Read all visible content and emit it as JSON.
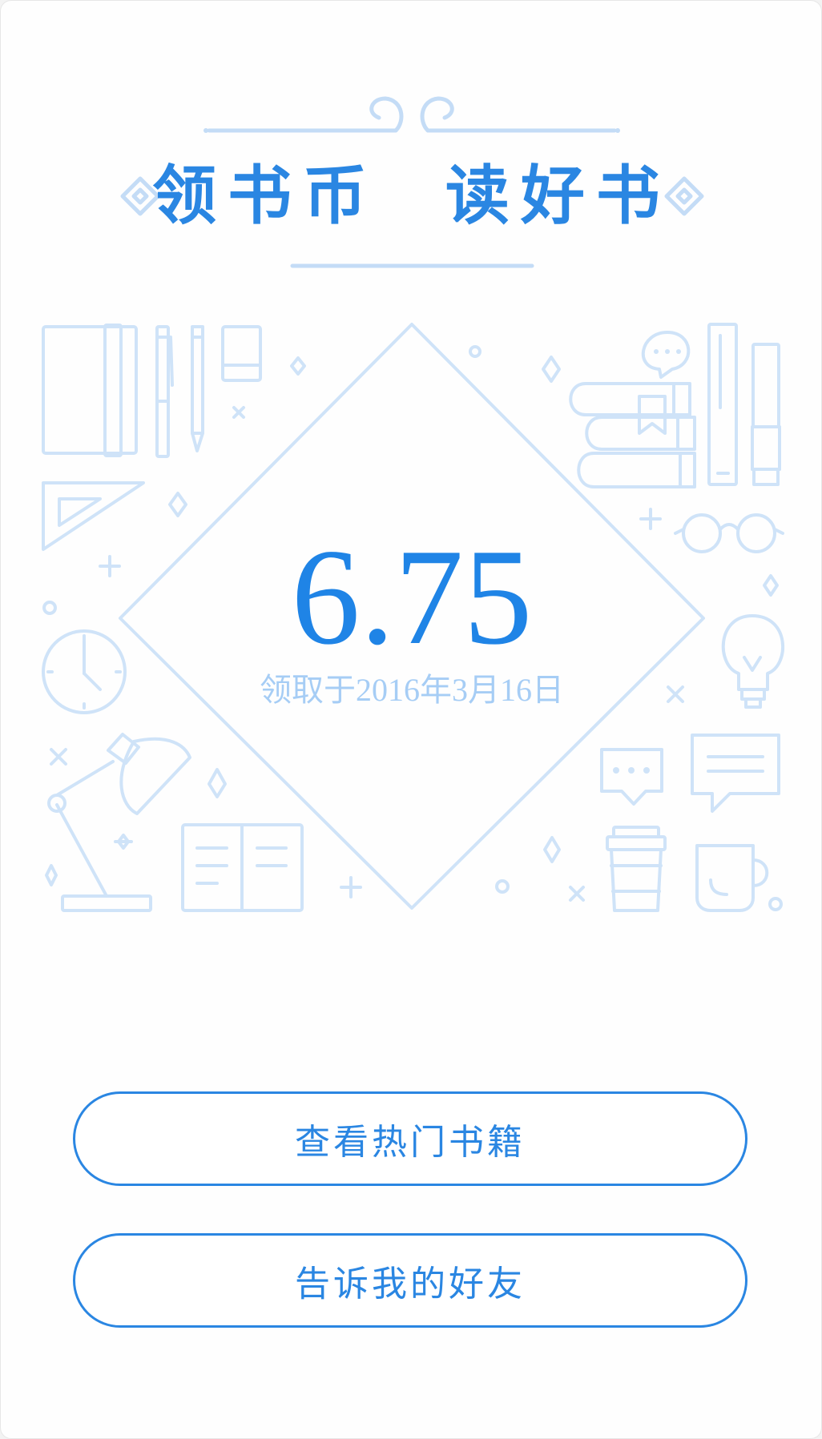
{
  "header": {
    "title": "领书币  读好书"
  },
  "reward": {
    "amount": "6.75",
    "claimed_text": "领取于2016年3月16日"
  },
  "actions": {
    "view_hot_books": "查看热门书籍",
    "tell_friends": "告诉我的好友"
  },
  "theme": {
    "accent": "#2a86e2",
    "line_art": "#cfe3f8",
    "background": "#fefefe"
  },
  "icons": [
    "cloud-ornament-icon",
    "diamond-icon",
    "notebook-icon",
    "pen-icon",
    "pencil-icon",
    "eraser-icon",
    "ruler-triangle-icon",
    "clock-icon",
    "desk-lamp-icon",
    "open-book-icon",
    "chat-bubble-icon",
    "book-stack-icon",
    "bookmark-icon",
    "glasses-icon",
    "lightbulb-icon",
    "speech-bubble-icon",
    "coffee-cup-icon",
    "mug-icon"
  ]
}
